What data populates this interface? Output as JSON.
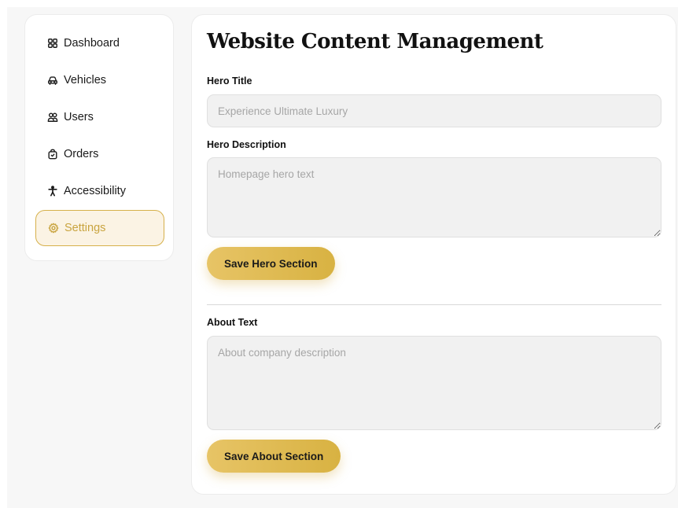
{
  "sidebar": {
    "items": [
      {
        "label": "Dashboard",
        "icon": "grid-icon",
        "active": false
      },
      {
        "label": "Vehicles",
        "icon": "car-icon",
        "active": false
      },
      {
        "label": "Users",
        "icon": "users-icon",
        "active": false
      },
      {
        "label": "Orders",
        "icon": "shopping-bag-icon",
        "active": false
      },
      {
        "label": "Accessibility",
        "icon": "accessibility-icon",
        "active": false
      },
      {
        "label": "Settings",
        "icon": "gear-icon",
        "active": true
      }
    ]
  },
  "main": {
    "title": "Website Content Management",
    "hero_title": {
      "label": "Hero Title",
      "value": "",
      "placeholder": "Experience Ultimate Luxury"
    },
    "hero_description": {
      "label": "Hero Description",
      "value": "",
      "placeholder": "Homepage hero text"
    },
    "save_hero_label": "Save Hero Section",
    "about_text": {
      "label": "About Text",
      "value": "",
      "placeholder": "About company description"
    },
    "save_about_label": "Save About Section"
  },
  "colors": {
    "accent": "#d6b04a",
    "active_bg": "#fbf3e4",
    "page_bg": "#f7f7f7",
    "input_bg": "#f1f1f1"
  }
}
